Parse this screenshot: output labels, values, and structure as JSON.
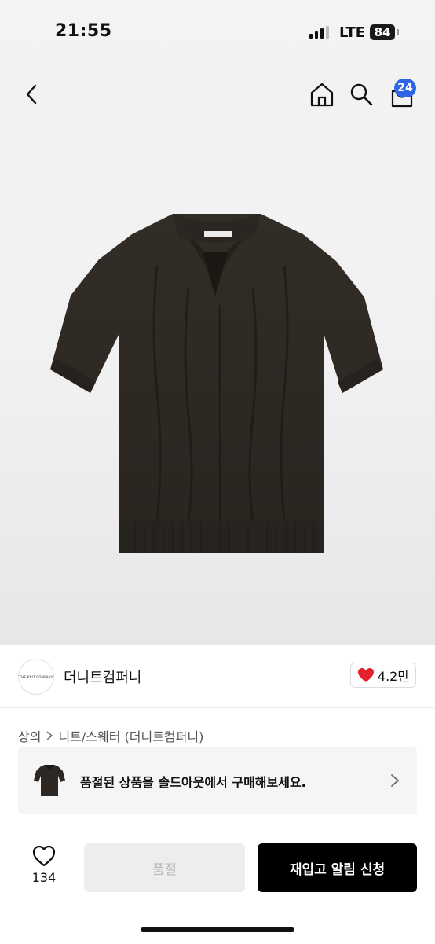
{
  "status_bar": {
    "time": "21:55",
    "network": "LTE",
    "battery": "84"
  },
  "nav": {
    "cart_count": "24"
  },
  "product": {
    "image_label": "THE KNIT COMPANY",
    "brand_logo_text": "THE KNIT COMPANY",
    "brand_name": "더니트컴퍼니",
    "likes": "4.2만",
    "breadcrumb": [
      "상의",
      "니트/스웨터 (더니트컴퍼니)"
    ]
  },
  "soldout_banner": {
    "text": "품절된 상품을 솔드아웃에서 구매해보세요."
  },
  "bottom_bar": {
    "wishlist_count": "134",
    "soldout_label": "품절",
    "restock_label": "재입고 알림 신청"
  },
  "colors": {
    "accent_badge": "#2f66e6",
    "heart": "#e5202e",
    "primary_button": "#000000",
    "sweater": "#2f2a25"
  }
}
